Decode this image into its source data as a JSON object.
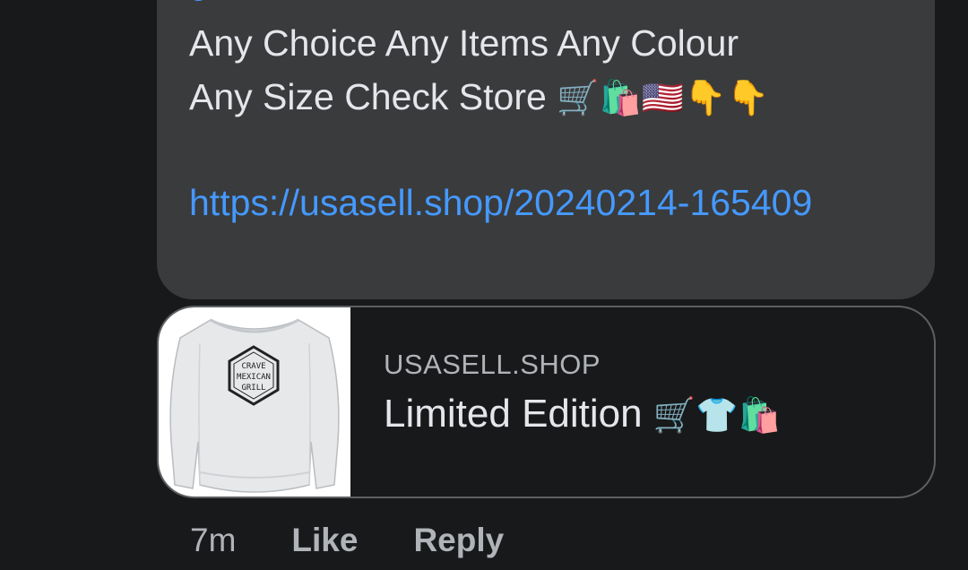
{
  "comment": {
    "line1": "Any Choice Any Items Any Colour",
    "line2": "Any Size Check Store",
    "line2_emoji": "🛒🛍️🇺🇸👇👇",
    "link": "https://usasell.shop/20240214-165409"
  },
  "preview": {
    "domain": "USASELL.SHOP",
    "title": "Limited Edition",
    "title_emoji": "🛒👕🛍️",
    "image_logo": [
      "CRAVE",
      "MEXICAN",
      "GRILL"
    ]
  },
  "actions": {
    "time": "7m",
    "like": "Like",
    "reply": "Reply"
  },
  "colors": {
    "background": "#18191a",
    "bubble": "#3a3b3c",
    "link": "#4599ff",
    "text": "#e4e6eb",
    "muted": "#b0b3b8"
  }
}
